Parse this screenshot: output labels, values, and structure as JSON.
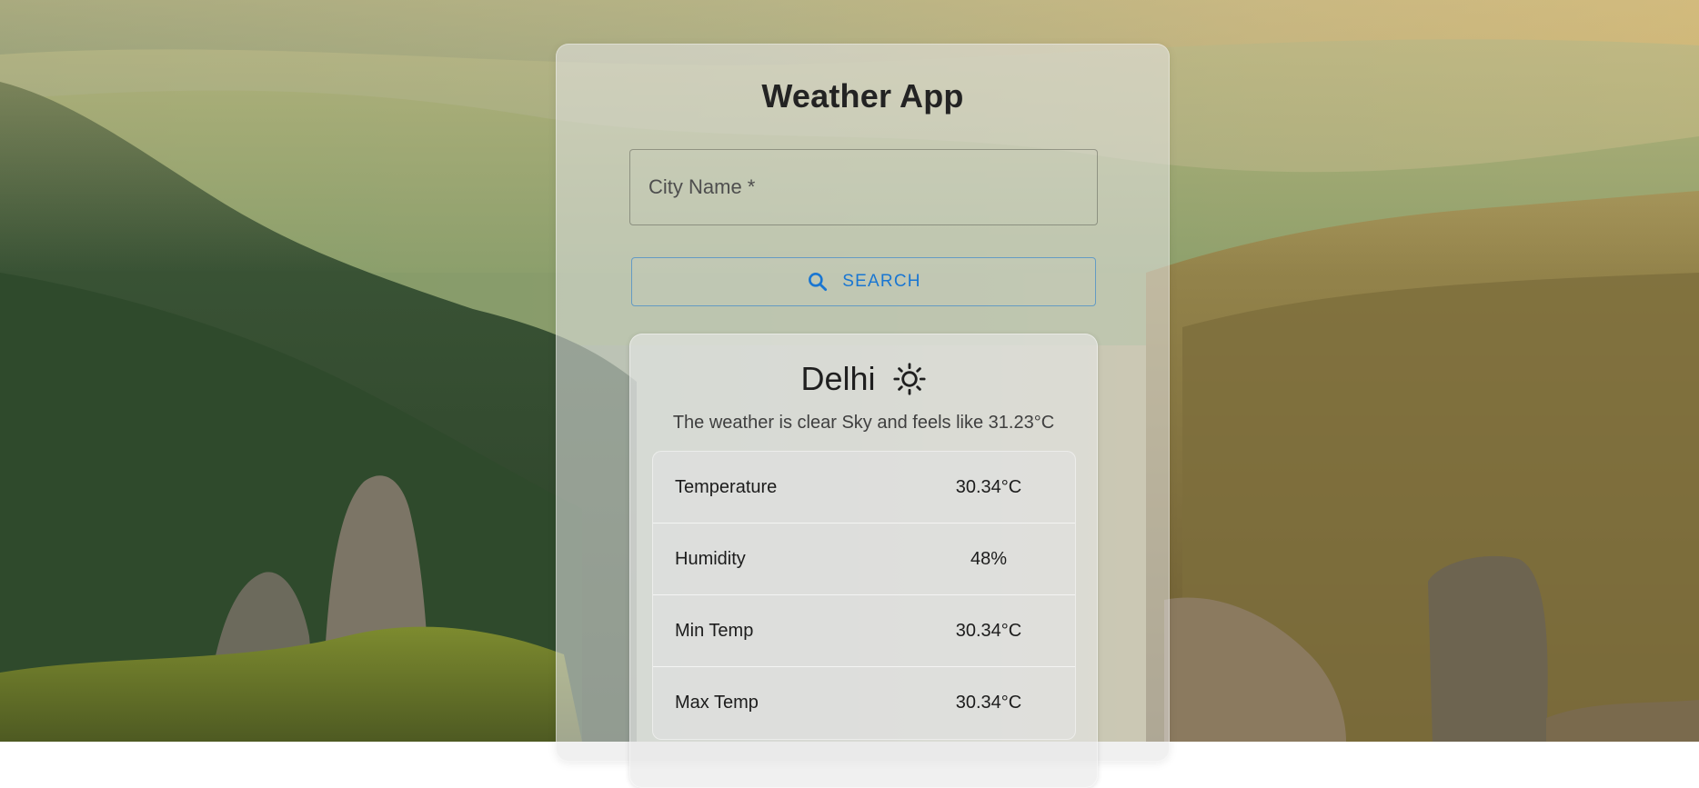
{
  "header": {
    "title": "Weather App"
  },
  "search": {
    "placeholder": "City Name *",
    "button_label": "SEARCH",
    "button_icon": "search-icon"
  },
  "weather": {
    "city": "Delhi",
    "condition_icon": "sun-icon",
    "description": "The weather is clear Sky and feels like 31.23°C",
    "stats": [
      {
        "label": "Temperature",
        "value": "30.34°C"
      },
      {
        "label": "Humidity",
        "value": "48%"
      },
      {
        "label": "Min Temp",
        "value": "30.34°C"
      },
      {
        "label": "Max Temp",
        "value": "30.34°C"
      }
    ]
  },
  "colors": {
    "accent": "#1976d2",
    "title_text": "#232323",
    "panel": "rgba(228,228,228,0.56)"
  }
}
